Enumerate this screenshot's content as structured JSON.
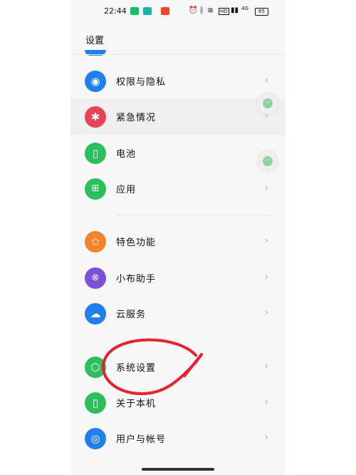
{
  "status_bar": {
    "time": "22:44",
    "network": "4G",
    "battery": "65"
  },
  "header": {
    "title": "设置"
  },
  "settings": {
    "group1": [
      {
        "label": "权限与隐私",
        "icon": "privacy-eye-icon",
        "color": "#2080e8"
      },
      {
        "label": "紧急情况",
        "icon": "emergency-asterisk-icon",
        "color": "#e94157"
      },
      {
        "label": "电池",
        "icon": "battery-icon",
        "color": "#2fbe5d"
      },
      {
        "label": "应用",
        "icon": "apps-grid-icon",
        "color": "#2fbe5d"
      }
    ],
    "group2": [
      {
        "label": "特色功能",
        "icon": "star-icon",
        "color": "#f2822b"
      },
      {
        "label": "小布助手",
        "icon": "assistant-icon",
        "color": "#7b4fd6"
      },
      {
        "label": "云服务",
        "icon": "cloud-icon",
        "color": "#2080e8"
      }
    ],
    "group3": [
      {
        "label": "系统设置",
        "icon": "system-gear-icon",
        "color": "#2fbe5d"
      },
      {
        "label": "关于本机",
        "icon": "phone-icon",
        "color": "#2fbe5d"
      },
      {
        "label": "用户与帐号",
        "icon": "user-icon",
        "color": "#2080e8"
      }
    ],
    "chevron": "›"
  },
  "floating": {
    "glyph": "···"
  },
  "annotation_color": "#e5232f"
}
